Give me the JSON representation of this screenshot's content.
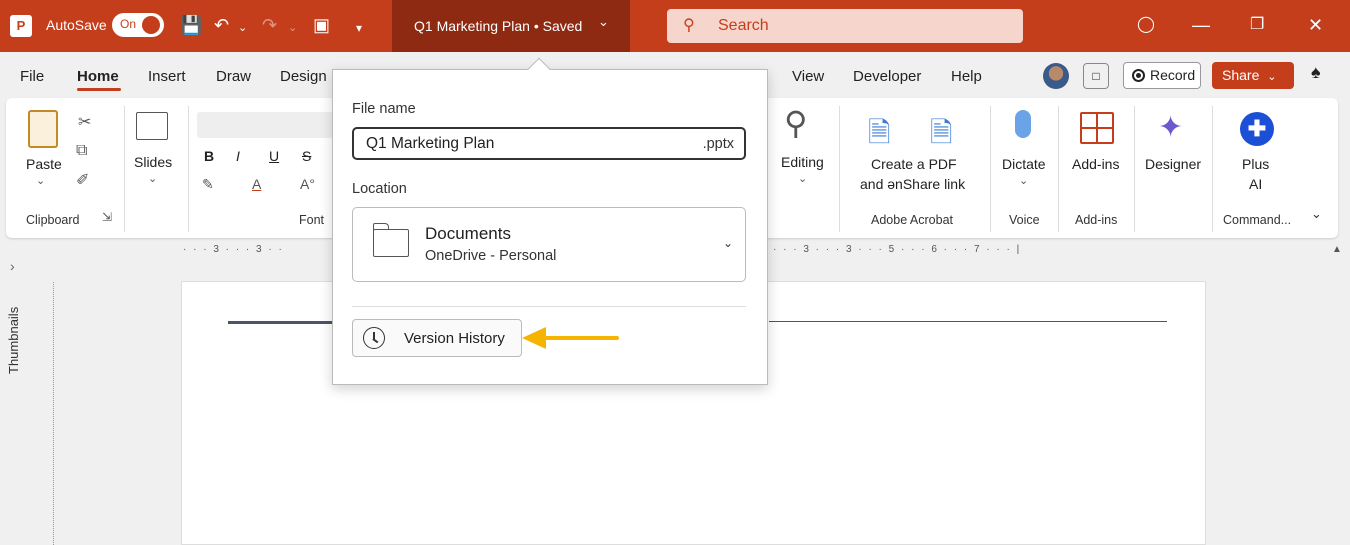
{
  "titlebar": {
    "app_icon": "P",
    "autosave_label": "AutoSave",
    "autosave_state": "On",
    "document_title": "Q1 Marketing Plan • Saved",
    "search_placeholder": "Search",
    "brand_color": "#c43e1c"
  },
  "menu": {
    "tabs": [
      "File",
      "Home",
      "Insert",
      "Draw",
      "Design",
      "View",
      "Developer",
      "Help"
    ],
    "record_label": "Record",
    "share_label": "Share"
  },
  "ribbon": {
    "paste": "Paste",
    "clipboard": "Clipboard",
    "slides": "Slides",
    "font": "Font",
    "font_bold": "B",
    "font_italic": "I",
    "font_underline": "U",
    "font_strike": "S",
    "editing": "Editing",
    "create_pdf_line1": "Create a PDF",
    "create_pdf_line2": "and ənShare link",
    "adobe_acrobat": "Adobe Acrobat",
    "dictate": "Dictate",
    "voice": "Voice",
    "addins": "Add-ins",
    "addins_group": "Add-ins",
    "designer": "Designer",
    "plus_line1": "Plus",
    "plus_line2": "AI",
    "commands": "Command..."
  },
  "ruler": {
    "marks": "· · · 3 · · · 3 · ·",
    "marks_right": "· · · 3 · · · 3 · · · 5 · · · 6 · · · 7 · · · |"
  },
  "sidebar": {
    "thumbnails_label": "Thumbnails"
  },
  "popup": {
    "file_name_label": "File name",
    "file_name_value": "Q1 Marketing Plan",
    "file_ext": ".pptx",
    "location_label": "Location",
    "location_name": "Documents",
    "location_sub": "OneDrive - Personal",
    "version_history": "Version History"
  },
  "annotation": {
    "arrow_color": "#f5b400"
  }
}
